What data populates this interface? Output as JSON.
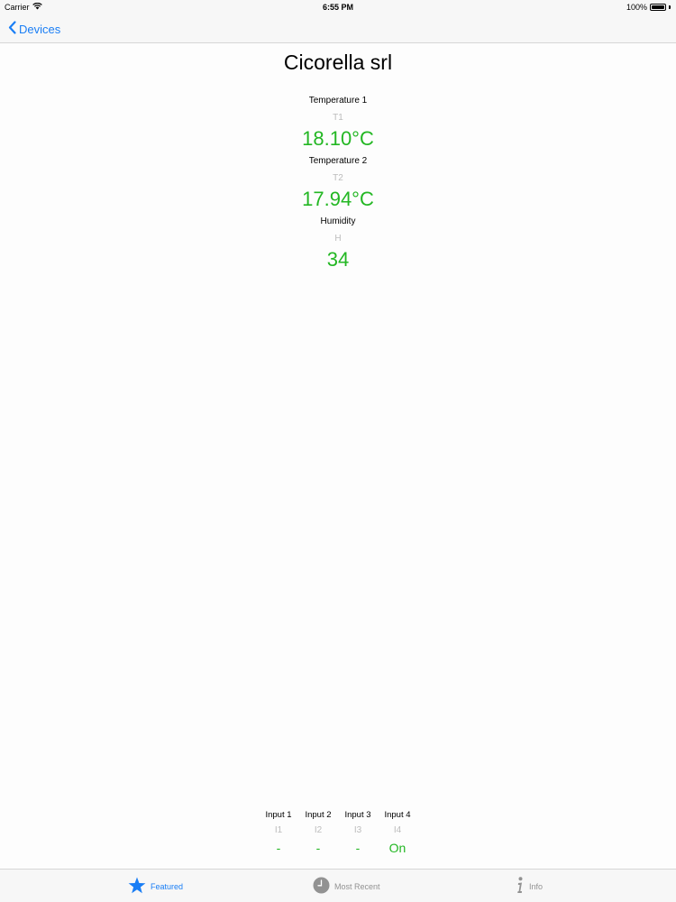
{
  "status_bar": {
    "carrier": "Carrier",
    "time": "6:55 PM",
    "battery": "100%",
    "battery_level": 1.0
  },
  "nav": {
    "back_label": "Devices"
  },
  "device": {
    "title": "Cicorella srl"
  },
  "sensors": [
    {
      "label": "Temperature 1",
      "code": "T1",
      "value": "18.10°C"
    },
    {
      "label": "Temperature 2",
      "code": "T2",
      "value": "17.94°C"
    },
    {
      "label": "Humidity",
      "code": "H",
      "value": "34"
    }
  ],
  "inputs": [
    {
      "label": "Input 1",
      "code": "I1",
      "value": "-"
    },
    {
      "label": "Input 2",
      "code": "I2",
      "value": "-"
    },
    {
      "label": "Input 3",
      "code": "I3",
      "value": "-"
    },
    {
      "label": "Input 4",
      "code": "I4",
      "value": "On"
    }
  ],
  "tabs": [
    {
      "label": "Featured",
      "icon": "star-icon",
      "active": true
    },
    {
      "label": "Most Recent",
      "icon": "clock-icon",
      "active": false
    },
    {
      "label": "Info",
      "icon": "info-icon",
      "active": false
    }
  ],
  "colors": {
    "accent": "#1a7ef5",
    "value_green": "#23b723",
    "code_gray": "#bcbcbc",
    "inactive_tab": "#929292"
  }
}
